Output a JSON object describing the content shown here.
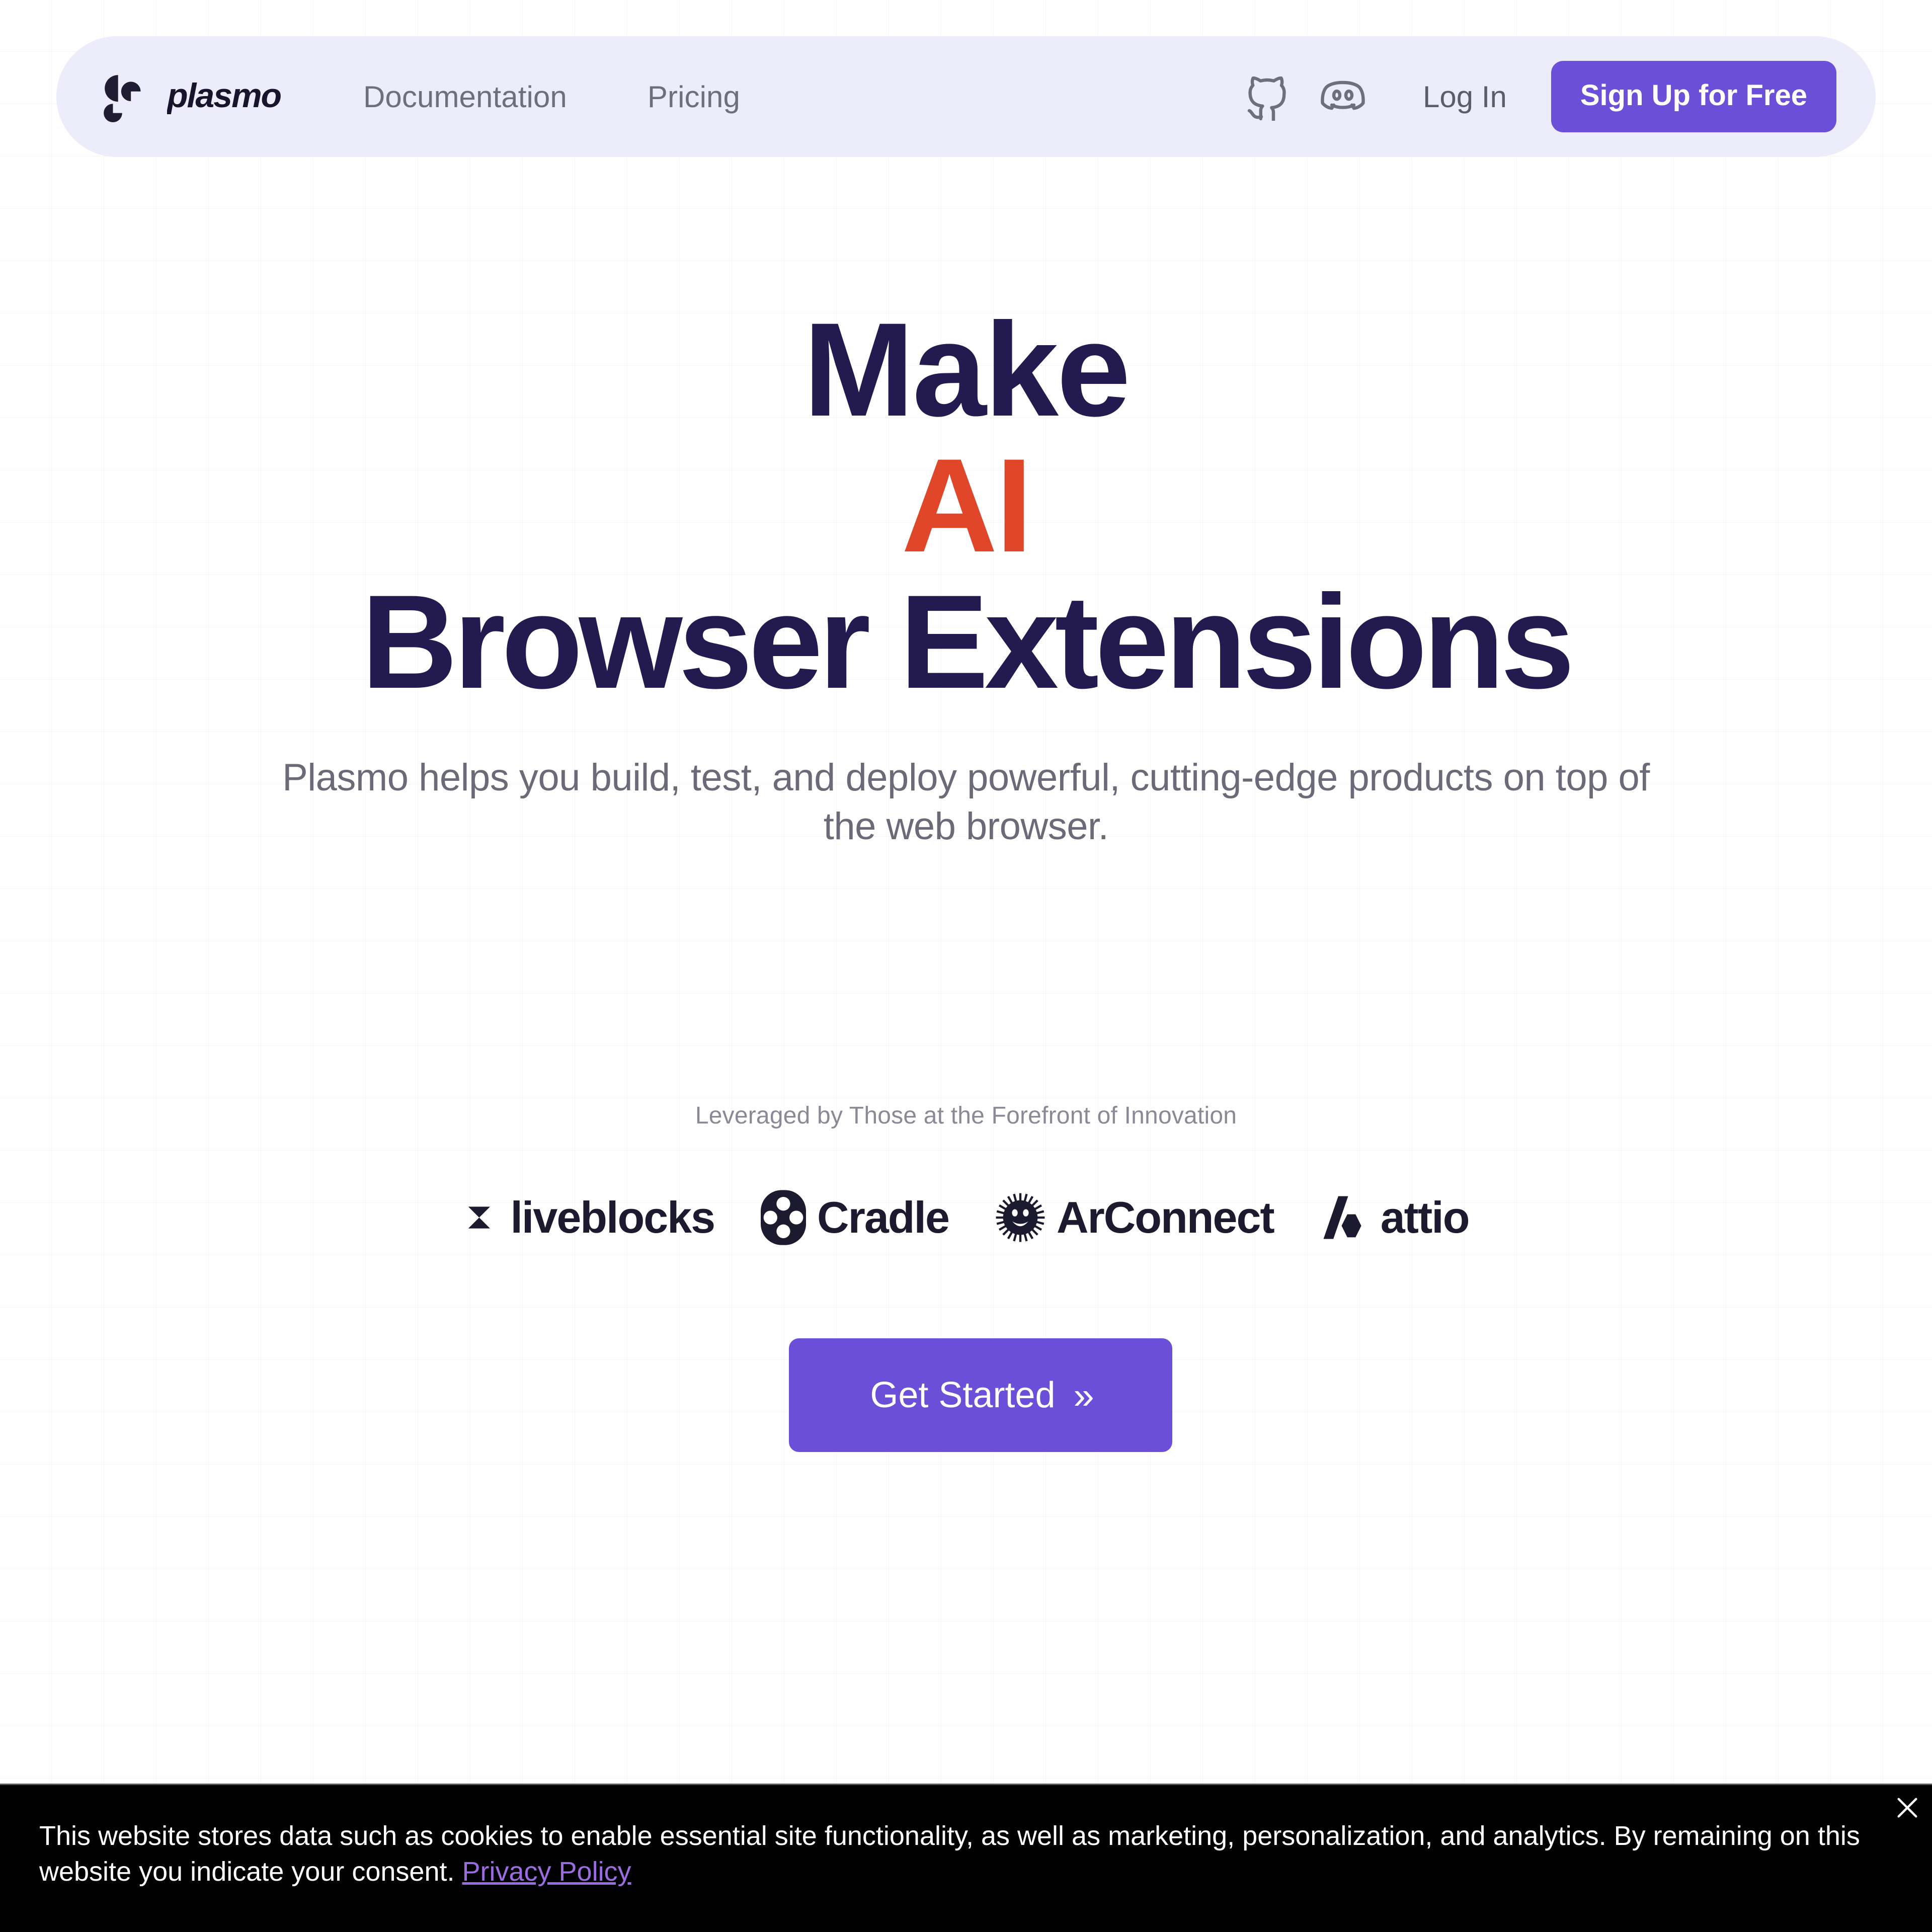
{
  "brand": {
    "name": "plasmo",
    "logo_icon": "plasmo-logo-icon",
    "mark_color": "#201d33"
  },
  "nav": {
    "links": [
      {
        "label": "Documentation"
      },
      {
        "label": "Pricing"
      }
    ],
    "github_icon": "github-icon",
    "discord_icon": "discord-icon",
    "login_label": "Log In",
    "signup_label": "Sign Up for Free",
    "signup_color": "#6c4fd8",
    "bar_background": "#edecfa"
  },
  "hero": {
    "line1": "Make",
    "line2": "AI",
    "line3": "Browser Extensions",
    "line2_color": "#e0472a",
    "heading_color": "#231a4f",
    "subtitle": "Plasmo helps you build, test, and deploy powerful, cutting-edge products on top of the web browser."
  },
  "social_proof": {
    "tagline": "Leveraged by Those at the Forefront of Innovation",
    "partners": [
      {
        "name": "liveblocks",
        "mark": "liveblocks-logo-icon"
      },
      {
        "name": "Cradle",
        "mark": "cradle-logo-icon"
      },
      {
        "name": "ArConnect",
        "mark": "arconnect-logo-icon"
      },
      {
        "name": "attio",
        "mark": "attio-logo-icon"
      }
    ]
  },
  "cta": {
    "label": "Get Started",
    "chevron": "»",
    "color": "#6c4fd8"
  },
  "cookie_banner": {
    "text_before_link": "This website stores data such as cookies to enable essential site functionality, as well as marketing, personalization, and analytics. By remaining on this website you indicate your consent. ",
    "link_label": "Privacy Policy",
    "link_color": "#9a6ce0",
    "background": "#000000",
    "close_icon": "close-icon"
  }
}
